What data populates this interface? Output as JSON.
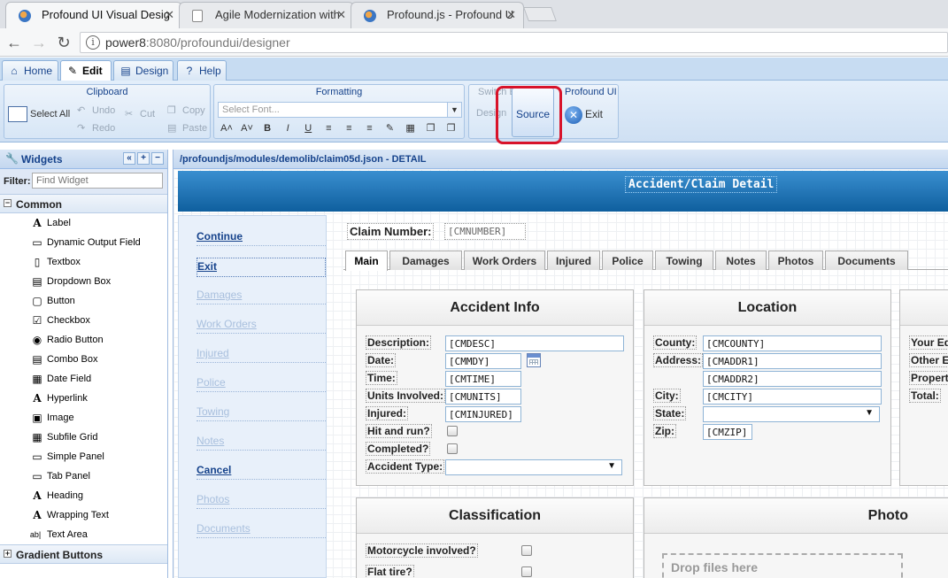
{
  "browser": {
    "tabs": [
      {
        "title": "Profound UI Visual Desig",
        "favicon": "pui"
      },
      {
        "title": "Agile Modernization with",
        "favicon": "doc"
      },
      {
        "title": "Profound.js - Profound U",
        "favicon": "pui"
      }
    ],
    "url_host": "power8",
    "url_rest": ":8080/profoundui/designer",
    "info_glyph": "i"
  },
  "ribbon_tabs": [
    {
      "label": "Home",
      "icon": "house-icon",
      "glyph": "⌂"
    },
    {
      "label": "Edit",
      "icon": "pencil-icon",
      "glyph": "✎"
    },
    {
      "label": "Design",
      "icon": "design-icon",
      "glyph": "▤"
    },
    {
      "label": "Help",
      "icon": "help-icon",
      "glyph": "?"
    }
  ],
  "clipboard": {
    "title": "Clipboard",
    "select_all": "Select All",
    "undo": "Undo",
    "redo": "Redo",
    "cut": "Cut",
    "copy": "Copy",
    "paste": "Paste"
  },
  "formatting": {
    "title": "Formatting",
    "font_placeholder": "Select Font...",
    "buttons": [
      "A˄",
      "A˅",
      "B",
      "I",
      "U",
      "≡",
      "≡",
      "≡",
      "✎",
      "▦",
      "❐",
      "❐"
    ]
  },
  "switch_view": {
    "title": "Switch Edit View",
    "design": "Design",
    "source": "Source"
  },
  "profound": {
    "title": "Profound UI",
    "exit": "Exit"
  },
  "widgets": {
    "title": "Widgets",
    "filter_label": "Filter:",
    "filter_placeholder": "Find Widget",
    "group": "Common",
    "items": [
      {
        "label": "Label",
        "icon": "label-icon",
        "glyph": "A"
      },
      {
        "label": "Dynamic Output Field",
        "icon": "output-field-icon",
        "glyph": "▭"
      },
      {
        "label": "Textbox",
        "icon": "textbox-icon",
        "glyph": "▯"
      },
      {
        "label": "Dropdown Box",
        "icon": "dropdown-icon",
        "glyph": "▤"
      },
      {
        "label": "Button",
        "icon": "button-icon",
        "glyph": "▢"
      },
      {
        "label": "Checkbox",
        "icon": "checkbox-icon",
        "glyph": "☑"
      },
      {
        "label": "Radio Button",
        "icon": "radio-icon",
        "glyph": "◉"
      },
      {
        "label": "Combo Box",
        "icon": "combo-icon",
        "glyph": "▤"
      },
      {
        "label": "Date Field",
        "icon": "date-icon",
        "glyph": "▦"
      },
      {
        "label": "Hyperlink",
        "icon": "hyperlink-icon",
        "glyph": "A"
      },
      {
        "label": "Image",
        "icon": "image-icon",
        "glyph": "▣"
      },
      {
        "label": "Subfile Grid",
        "icon": "grid-icon",
        "glyph": "▦"
      },
      {
        "label": "Simple Panel",
        "icon": "panel-icon",
        "glyph": "▭"
      },
      {
        "label": "Tab Panel",
        "icon": "tab-panel-icon",
        "glyph": "▭"
      },
      {
        "label": "Heading",
        "icon": "heading-icon",
        "glyph": "A"
      },
      {
        "label": "Wrapping Text",
        "icon": "wrap-text-icon",
        "glyph": "A"
      },
      {
        "label": "Text Area",
        "icon": "textarea-icon",
        "glyph": "ab|"
      }
    ],
    "next_group": "Gradient Buttons"
  },
  "designer": {
    "path": "/profoundjs/modules/demolib/claim05d.json - DETAIL",
    "banner_title": "Accident/Claim Detail",
    "nav_links": [
      {
        "label": "Continue",
        "enabled": true
      },
      {
        "label": "Exit",
        "enabled": true
      },
      {
        "label": "Damages",
        "enabled": false
      },
      {
        "label": "Work Orders",
        "enabled": false
      },
      {
        "label": "Injured",
        "enabled": false
      },
      {
        "label": "Police",
        "enabled": false
      },
      {
        "label": "Towing",
        "enabled": false
      },
      {
        "label": "Notes",
        "enabled": false
      },
      {
        "label": "Cancel",
        "enabled": true
      },
      {
        "label": "Photos",
        "enabled": false
      },
      {
        "label": "Documents",
        "enabled": false
      }
    ],
    "claim_label": "Claim Number:",
    "claim_field": "[CMNUMBER]",
    "tabs": [
      "Main",
      "Damages",
      "Work Orders",
      "Injured",
      "Police",
      "Towing",
      "Notes",
      "Photos",
      "Documents"
    ],
    "active_tab": "Main",
    "accident": {
      "title": "Accident Info",
      "description_label": "Description:",
      "description_value": "[CMDESC]",
      "date_label": "Date:",
      "date_value": "[CMMDY]",
      "time_label": "Time:",
      "time_value": "[CMTIME]",
      "units_label": "Units Involved:",
      "units_value": "[CMUNITS]",
      "injured_label": "Injured:",
      "injured_value": "[CMINJURED]",
      "hitrun_label": "Hit and run?",
      "completed_label": "Completed?",
      "type_label": "Accident Type:"
    },
    "location": {
      "title": "Location",
      "county_label": "County:",
      "county_value": "[CMCOUNTY]",
      "address_label": "Address:",
      "addr1_value": "[CMADDR1]",
      "addr2_value": "[CMADDR2]",
      "city_label": "City:",
      "city_value": "[CMCITY]",
      "state_label": "State:",
      "zip_label": "Zip:",
      "zip_value": "[CMZIP]"
    },
    "third_panel": {
      "labels": [
        "Your Eq",
        "Other E",
        "Propert",
        "Total:"
      ]
    },
    "classification": {
      "title": "Classification",
      "motorcycle_label": "Motorcycle involved?",
      "flat_tire_label": "Flat tire?"
    },
    "photo": {
      "title": "Photo",
      "dropzone": "Drop files here"
    }
  }
}
